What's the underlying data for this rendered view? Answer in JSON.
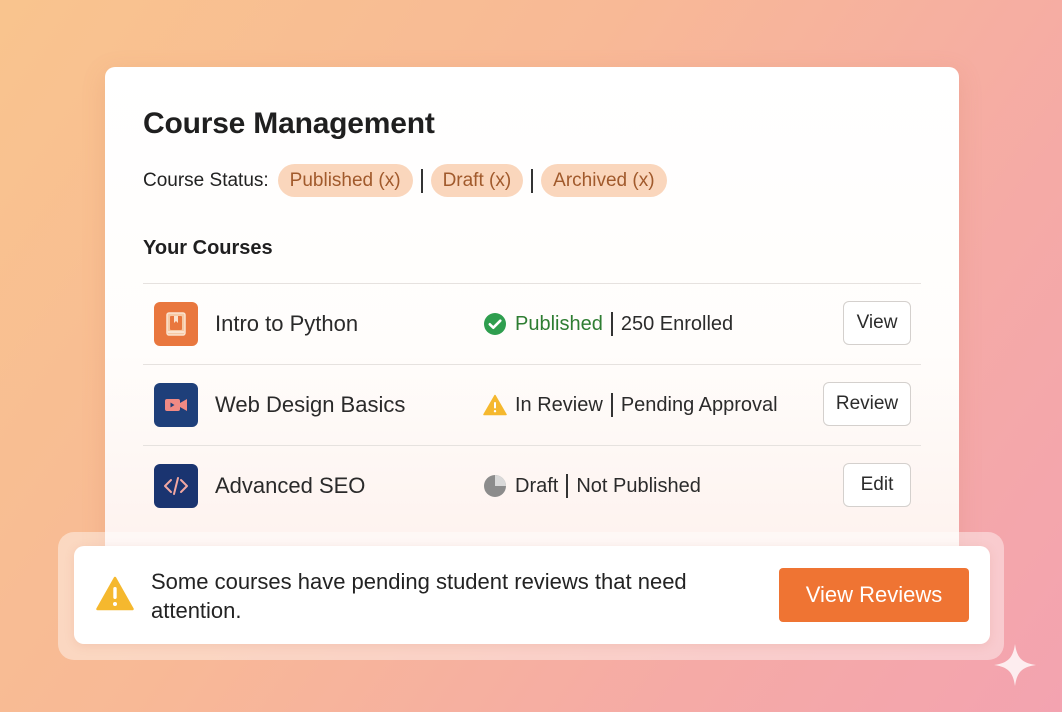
{
  "page": {
    "title": "Course Management",
    "status_filter": {
      "label": "Course Status:",
      "chips": [
        "Published (x)",
        "Draft (x)",
        "Archived (x)"
      ]
    },
    "section_title": "Your Courses"
  },
  "courses": [
    {
      "name": "Intro to Python",
      "icon": "book-icon",
      "status_icon": "check-circle-icon",
      "status": "Published",
      "detail": "250 Enrolled",
      "action": "View"
    },
    {
      "name": "Web Design Basics",
      "icon": "video-camera-icon",
      "status_icon": "warning-icon",
      "status": "In Review",
      "detail": "Pending Approval",
      "action": "Review"
    },
    {
      "name": "Advanced SEO",
      "icon": "code-icon",
      "status_icon": "pie-chart-icon",
      "status": "Draft",
      "detail": "Not Published",
      "action": "Edit"
    }
  ],
  "notice": {
    "icon": "warning-icon",
    "text": "Some courses have pending student reviews that need attention.",
    "button": "View Reviews"
  },
  "colors": {
    "accent": "#ef7433",
    "chip_bg": "#fad6bc",
    "chip_text": "#a15a2c",
    "published_green": "#2e7d32",
    "warning_yellow": "#f5b82e",
    "python_icon_bg": "#e9773e",
    "web_icon_bg": "#1e3f7a",
    "seo_icon_bg": "#1a3470"
  }
}
